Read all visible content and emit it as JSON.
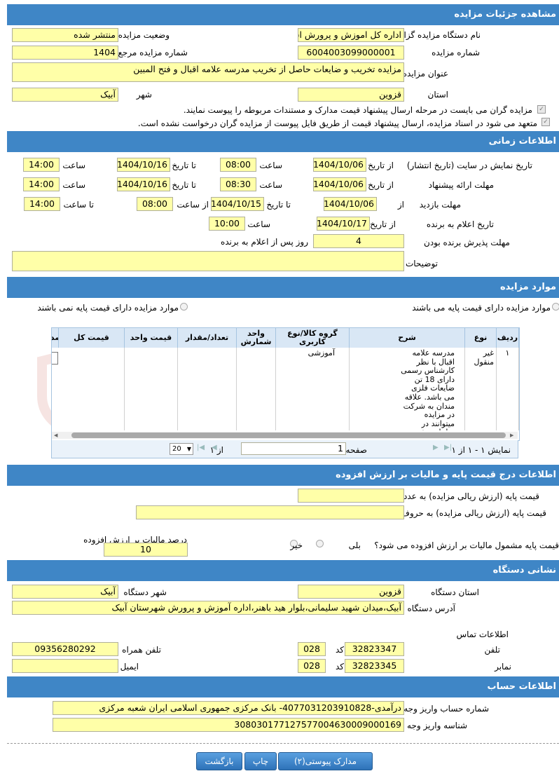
{
  "sections": {
    "details": "مشاهده جزئیات مزایده",
    "time": "اطلاعات زمانی",
    "items": "موارد مزایده",
    "price": "اطلاعات درج قیمت پایه و مالیات بر ارزش افزوده",
    "address": "نشانی دستگاه",
    "account": "اطلاعات حساب"
  },
  "details": {
    "org_label": "نام دستگاه مزایده گزار",
    "org_value": "اداره کل اموزش و پرورش استان قزوین",
    "status_label": "وضعیت مزایده",
    "status_value": "منتشر شده",
    "number_label": "شماره مزایده",
    "number_value": "6004003099000001",
    "ref_label": "شماره مزایده مرجع",
    "ref_value": "1404",
    "title_label": "عنوان مزایده",
    "title_value": "مزایده تخریب و ضایعات حاصل از تخریب مدرسه علامه اقبال و فتح المبین",
    "province_label": "استان",
    "province_value": "قزوین",
    "city_label": "شهر",
    "city_value": "آبیک",
    "check1": "مزایده گران می بایست در مرحله ارسال پیشنهاد قیمت مدارک و مستندات مربوطه را پیوست نمایند.",
    "check2": "متعهد می شود در اسناد مزایده، ارسال پیشنهاد قیمت از طریق فایل پیوست از مزایده گران درخواست نشده است."
  },
  "time": {
    "display_label": "تاریخ نمایش در سایت (تاریخ انتشار)",
    "from_date": "از تاریخ",
    "to_date": "تا تاریخ",
    "hour": "ساعت",
    "display_from": "1404/10/06",
    "display_from_time": "08:00",
    "display_to": "1404/10/16",
    "display_to_time": "14:00",
    "offer_label": "مهلت ارائه پیشنهاد",
    "offer_from": "1404/10/06",
    "offer_from_time": "08:30",
    "offer_to": "1404/10/16",
    "offer_to_time": "14:00",
    "visit_label": "مهلت بازدید",
    "visit_from_label": "از",
    "visit_from": "1404/10/06",
    "visit_to_label": "تا تاریخ",
    "visit_to": "1404/10/15",
    "visit_from_hour_label": "از ساعت",
    "visit_from_hour": "08:00",
    "visit_to_hour_label": "تا ساعت",
    "visit_to_hour": "14:00",
    "winner_label": "تاریخ اعلام به برنده",
    "winner_from_label": "از تاریخ",
    "winner_date": "1404/10/17",
    "winner_hour_label": "ساعت",
    "winner_hour": "10:00",
    "accept_label": "مهلت پذیرش برنده بودن",
    "accept_value": "4",
    "accept_suffix": "روز پس از اعلام به برنده",
    "notes_label": "توضیحات",
    "notes_value": ""
  },
  "items": {
    "radio_with": "موارد مزایده دارای قیمت پایه می باشند",
    "radio_without": "موارد مزایده دارای قیمت پایه نمی باشند",
    "columns": [
      "ردیف",
      "نوع",
      "شرح",
      "گروه کالا/نوع کاربری",
      "واحد شمارش",
      "تعداد/مقدار",
      "قیمت واحد",
      "قیمت کل",
      "مد"
    ],
    "row": {
      "index": "۱",
      "type": "غیر منقول",
      "desc": "مدرسه علامه اقبال با نظر کارشناس رسمی دارای 18 تن ضایعات فلزی می باشد. علاقه مندان به شرکت در مزایده میتوانند در ساعات مقرر شده از ساختمان بازدید داشته باشند و پیشنهاد خود را بعد از بازدید اعلام کنند.",
      "group": "آموزشی",
      "unit": "",
      "qty": "",
      "unit_price": "",
      "total": ""
    },
    "pager": {
      "summary": "نمایش ۱ - ۱ از ۱",
      "page_label": "صفحه",
      "page_value": "1",
      "of_label": "از ۱",
      "page_size": "20"
    }
  },
  "price": {
    "base_num_label": "قیمت پایه (ارزش ریالی مزایده) به عدد",
    "base_num_value": "",
    "base_words_label": "قیمت پایه (ارزش ریالی مزایده) به حروف",
    "base_words_value": "",
    "vat_question": "قیمت پایه مشمول مالیات بر ارزش افزوده می شود؟",
    "yes": "بلی",
    "no": "خیر",
    "vat_percent_label": "درصد مالیات بر ارزش افزوده",
    "vat_percent_value": "10"
  },
  "address": {
    "province_label": "استان دستگاه",
    "province_value": "قزوین",
    "city_label": "شهر دستگاه",
    "city_value": "آبیک",
    "address_label": "آدرس دستگاه",
    "address_value": "آبیک،میدان شهید سلیمانی،بلوار هید باهنر،اداره آموزش و پرورش شهرستان آبیک",
    "contact_label": "اطلاعات تماس",
    "phone_label": "تلفن",
    "phone_value": "32823347",
    "code_label": "کد",
    "phone_code": "028",
    "mobile_label": "تلفن همراه",
    "mobile_value": "09356280292",
    "fax_label": "نمابر",
    "fax_value": "32823345",
    "fax_code": "028",
    "email_label": "ایمیل",
    "email_value": ""
  },
  "account": {
    "account_label": "شماره حساب واریز وجه",
    "account_value": "درآمدی-4077031203910828- بانک مرکزی جمهوری اسلامی ایران شعبه مرکزی",
    "id_label": "شناسه واریز وجه",
    "id_value": "308030177127577004630009000169"
  },
  "buttons": {
    "attachments": "مدارک پیوستی(۲)",
    "print": "چاپ",
    "back": "بازگشت"
  },
  "watermark_text": "AriaTender",
  "colors": {
    "header": "#3f86c6",
    "field": "#ffffa8",
    "button": "#2d72b8"
  }
}
